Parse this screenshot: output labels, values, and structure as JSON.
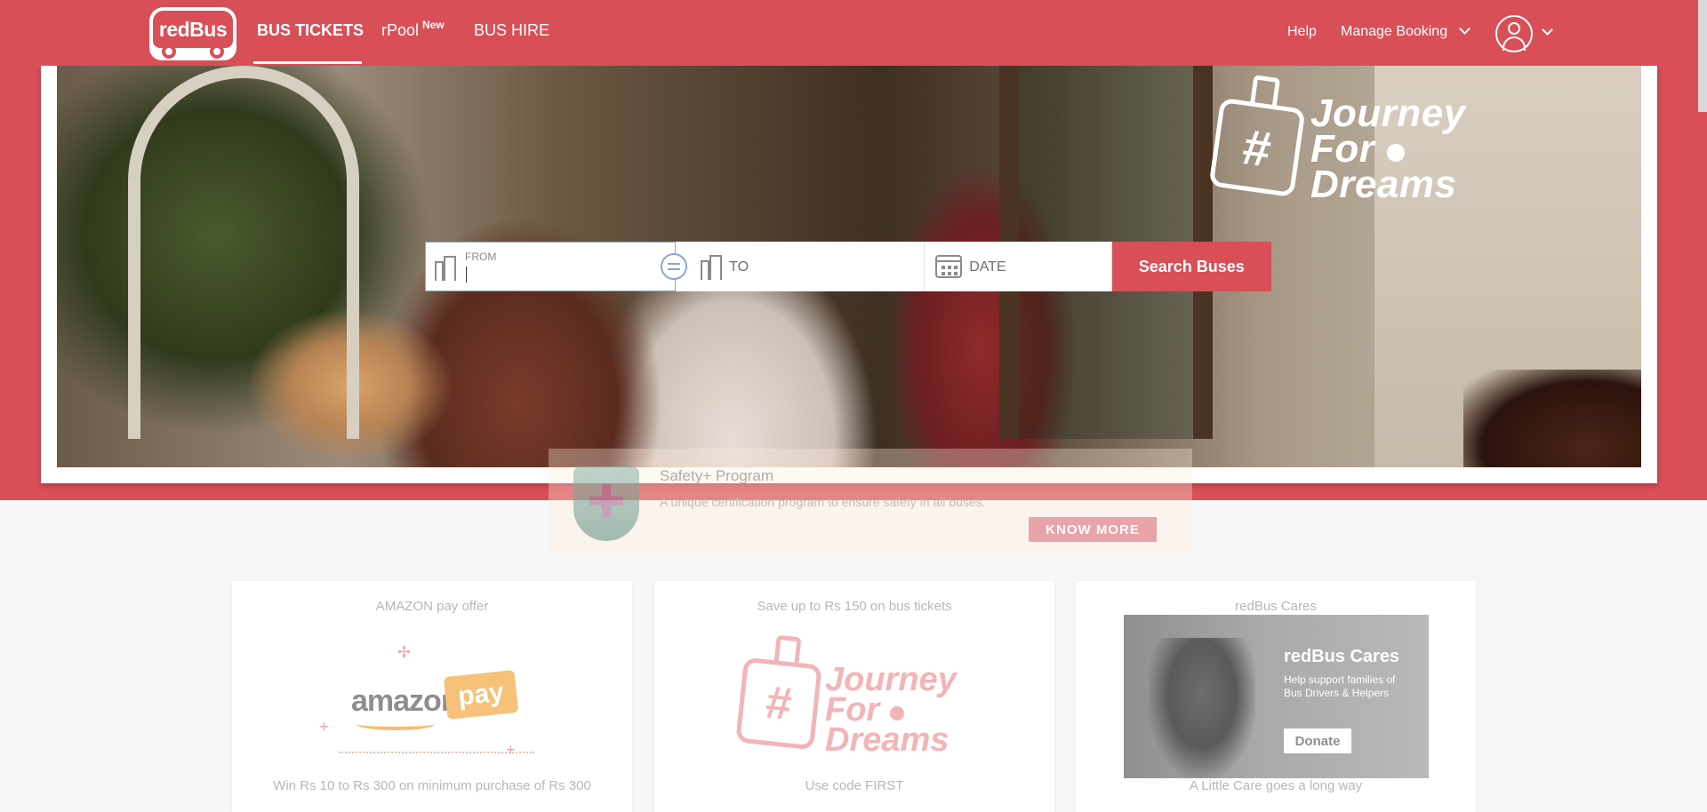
{
  "header": {
    "logo_text": "redBus",
    "nav": {
      "bus_tickets": "BUS TICKETS",
      "rpool": "rPool",
      "rpool_badge": "New",
      "bus_hire": "BUS HIRE"
    },
    "help": "Help",
    "manage_booking": "Manage Booking"
  },
  "hero": {
    "brand_words": [
      "Journey",
      "For",
      "Dreams"
    ],
    "brand_hash": "#"
  },
  "search": {
    "from_small_label": "FROM",
    "to_label": "TO",
    "date_label": "DATE",
    "button": "Search Buses"
  },
  "safety": {
    "title": "Safety+ Program",
    "description": "A unique certification program to ensure safety in all buses.",
    "button": "KNOW MORE"
  },
  "offers": [
    {
      "title": "AMAZON pay offer",
      "footer": "Win Rs 10 to Rs 300 on minimum purchase of Rs 300",
      "logo_word": "amazon",
      "logo_pay": "pay"
    },
    {
      "title": "Save up to Rs 150 on bus tickets",
      "footer": "Use code FIRST",
      "brand_words": [
        "Journey",
        "For",
        "Dreams"
      ],
      "brand_hash": "#"
    },
    {
      "title": "redBus Cares",
      "footer": "A Little Care goes a long way",
      "image_title": "redBus Cares",
      "image_text": "Help support families of Bus Drivers & Helpers",
      "image_button": "Donate"
    }
  ],
  "colors": {
    "brand_red": "#d84f57",
    "page_bg": "#f7f7f7"
  },
  "icons": {
    "from": "building-icon",
    "to": "building-icon",
    "swap": "swap-icon",
    "date": "calendar-icon",
    "user": "user-icon",
    "dropdown": "chevron-down-icon",
    "safety": "shield-plus-icon"
  }
}
